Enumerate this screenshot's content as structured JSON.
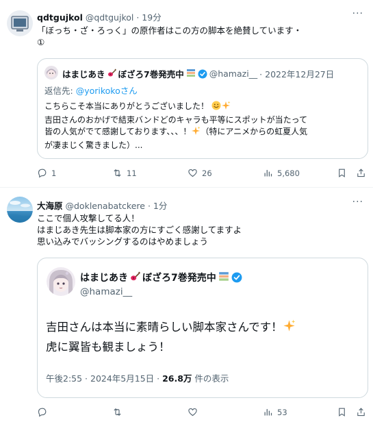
{
  "post1": {
    "author_name": "qdtgujkol",
    "handle": "@qdtgujkol",
    "time": "19分",
    "text_lines": [
      "「ぼっち・ざ・ろっく」の原作者はこの方の脚本を絶賛しています・",
      "①"
    ],
    "quote": {
      "author_name": "はまじあき",
      "name_suffix": "ぼざろ7巻発売中",
      "handle": "@hamazi__",
      "date": "· 2022年12月27日",
      "reply_prefix": "返信先: ",
      "reply_to": "@yorikokoさん",
      "text_lines": [
        "こちらこそ本当にありがとうございました！",
        "吉田さんのおかげで結束バンドどのキャラも平等にスポットが当たって",
        "皆の人気がでて感謝しております、、、！",
        "（特にアニメからの虹夏人気",
        "が凄まじく驚きました）..."
      ]
    },
    "actions": {
      "replies": "1",
      "retweets": "11",
      "likes": "26",
      "views": "5,680"
    }
  },
  "post2": {
    "author_name": "大海原",
    "handle": "@doklenabatckere",
    "time": "· 1分",
    "text_lines": [
      "ここで個人攻撃してる人！",
      "はまじあき先生は脚本家の方にすごく感謝してますよ",
      "思い込みでバッシングするのはやめましょう"
    ],
    "quote": {
      "author_name": "はまじあき",
      "name_suffix": "ぼざろ7巻発売中",
      "handle": "@hamazi__",
      "text_lines": [
        "吉田さんは本当に素晴らしい脚本家さんです！",
        "虎に翼皆も観ましょう！"
      ],
      "meta_time": "午後2:55 · 2024年5月15日 · ",
      "meta_views": "26.8万",
      "meta_views_suffix": " 件の表示"
    },
    "actions": {
      "replies": "",
      "retweets": "",
      "likes": "",
      "views": "53"
    }
  },
  "colors": {
    "accent_blue": "#1d9bf0",
    "text_secondary": "#536471",
    "border": "#cfd9de"
  }
}
